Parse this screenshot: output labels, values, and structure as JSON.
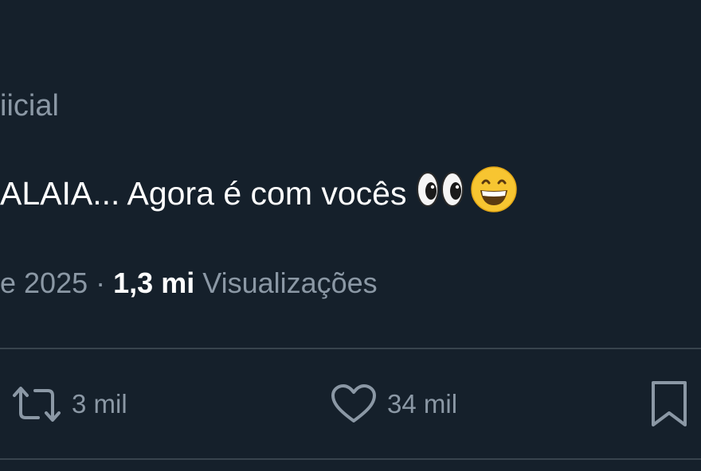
{
  "tweet": {
    "handle": "iicial",
    "text": "ALAIA... Agora é com vocês",
    "emojis": [
      "eyes-icon",
      "grinning-face-icon"
    ],
    "date_fragment": "e 2025",
    "separator": "·",
    "views_count": "1,3 mi",
    "views_label": "Visualizações"
  },
  "actions": {
    "retweets": "3 mil",
    "likes": "34 mil"
  },
  "colors": {
    "background": "#15202b",
    "primary_text": "#ffffff",
    "secondary_text": "#8b98a5",
    "divider": "#38444d"
  }
}
